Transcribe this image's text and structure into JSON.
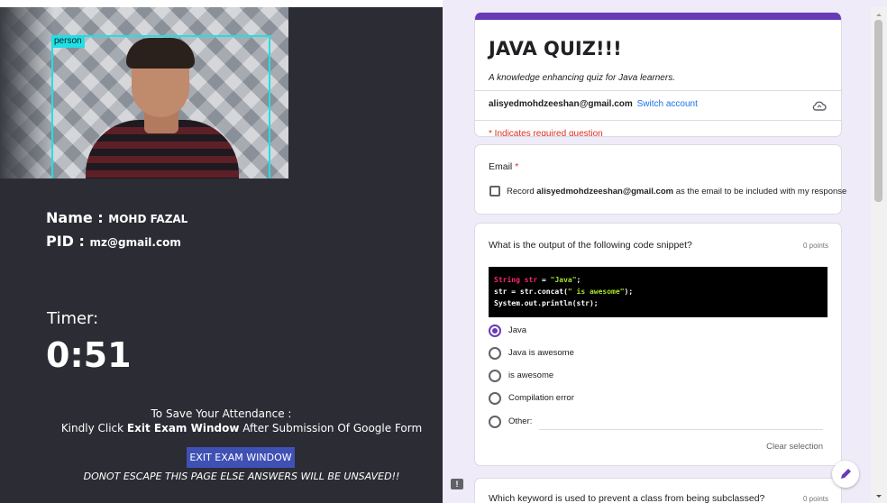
{
  "camera": {
    "detection_label": "person"
  },
  "student": {
    "name_label": "Name :",
    "name_value": "MOHD FAZAL",
    "pid_label": "PID :",
    "pid_value": "mz@gmail.com"
  },
  "timer": {
    "label": "Timer:",
    "value": "0:51"
  },
  "instructions": {
    "line1": "To Save Your Attendance :",
    "line2_prefix": "Kindly Click",
    "line2_bold": "Exit Exam Window",
    "line2_suffix": "After Submission Of Google Form",
    "exit_button": "EXIT EXAM WINDOW",
    "warning": "DONOT ESCAPE THIS PAGE ELSE ANSWERS WILL BE UNSAVED!!"
  },
  "form": {
    "accent_color": "#673ab7",
    "title": "JAVA QUIZ!!!",
    "description": "A knowledge enhancing quiz for Java learners.",
    "account_email": "alisyedmohdzeeshan@gmail.com",
    "switch_account": "Switch account",
    "required_note": "* Indicates required question",
    "email_question": {
      "title": "Email",
      "required_marker": "*",
      "checkbox_prefix": "Record",
      "checkbox_email": "alisyedmohdzeeshan@gmail.com",
      "checkbox_suffix": "as the email to be included with my response",
      "checked": false
    },
    "question1": {
      "title": "What is the output of the following code snippet?",
      "points": "0 points",
      "code": {
        "line1_keyword": "String str",
        "line1_op": " = ",
        "line1_string": "\"Java\"",
        "line1_end": ";",
        "line2_start": "str = str.concat(",
        "line2_string": "\" is awesome\"",
        "line2_end": ");",
        "line3": "System.out.println(str);"
      },
      "options": [
        {
          "label": "Java",
          "selected": true
        },
        {
          "label": "Java is awesome",
          "selected": false
        },
        {
          "label": "is awesome",
          "selected": false
        },
        {
          "label": "Compilation error",
          "selected": false
        },
        {
          "label": "Other:",
          "selected": false
        }
      ],
      "clear_selection": "Clear selection"
    },
    "question2": {
      "title": "Which keyword is used to prevent a class from being subclassed?",
      "points": "0 points"
    }
  }
}
